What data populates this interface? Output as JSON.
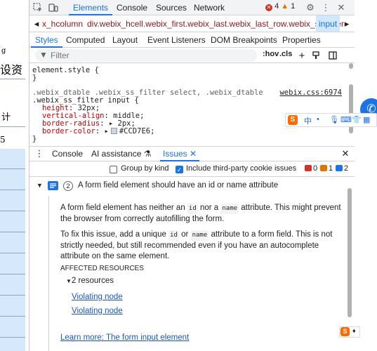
{
  "page_left": {
    "row1": "g",
    "row2": "设资",
    "row3": "计",
    "row4": "5"
  },
  "toolbar": {
    "tabs": [
      "Elements",
      "Console",
      "Sources",
      "Network"
    ],
    "error_count": "4",
    "warning_count": "1"
  },
  "breadcrumb": {
    "items": [
      "x_hcolumn",
      "div.webix_hcell.webix_first.webix_last.webix_last_row.webix_ss_filter",
      "input"
    ]
  },
  "subtabs": [
    "Styles",
    "Computed",
    "Layout",
    "Event Listeners",
    "DOM Breakpoints",
    "Properties"
  ],
  "filter": {
    "placeholder": "Filter",
    "hov": ":hov",
    "cls": ".cls"
  },
  "styles": {
    "element_style": "element.style {",
    "close_brace": "}",
    "rule_selector_1": ".webix_dtable .webix_ss_filter select, .webix_dtable",
    "rule_selector_2": ".webix_ss_filter input {",
    "rule_source": "webix.css:6974",
    "props": [
      {
        "name": "height",
        "value": "32px;"
      },
      {
        "name": "vertical-align",
        "value": "middle;"
      },
      {
        "name": "border-radius",
        "value": "2px;"
      },
      {
        "name": "border-color",
        "value": "#CCD7E6;"
      }
    ]
  },
  "drawer": {
    "tabs": [
      "Console",
      "AI assistance",
      "Issues"
    ]
  },
  "issues_toolbar": {
    "group_by_kind": "Group by kind",
    "include_third_party": "Include third-party cookie issues",
    "count_red": "0",
    "count_orange": "1",
    "count_blue": "2"
  },
  "issue": {
    "count": "2",
    "title": "A form field element should have an id or name attribute",
    "para1_a": "A form field element has neither an",
    "para1_code1": "id",
    "para1_b": "nor a",
    "para1_code2": "name",
    "para1_c": "attribute. This might prevent the browser from correctly autofilling the form.",
    "para2_a": "To fix this issue, add a unique",
    "para2_code1": "id",
    "para2_b": "or",
    "para2_code2": "name",
    "para2_c": "attribute to a form field. This is not strictly needed, but still recommended even if you have an autocomplete attribute on the same element.",
    "affected": "AFFECTED RESOURCES",
    "resources": "2 resources",
    "violating_1": "Violating node",
    "violating_2": "Violating node",
    "learn_more": "Learn more: The form input element"
  },
  "ime": {
    "logo": "S",
    "items": [
      "中",
      "•",
      "♦"
    ]
  },
  "colors": {
    "accent": "#1a73e8",
    "swatch": "#CCD7E6"
  }
}
